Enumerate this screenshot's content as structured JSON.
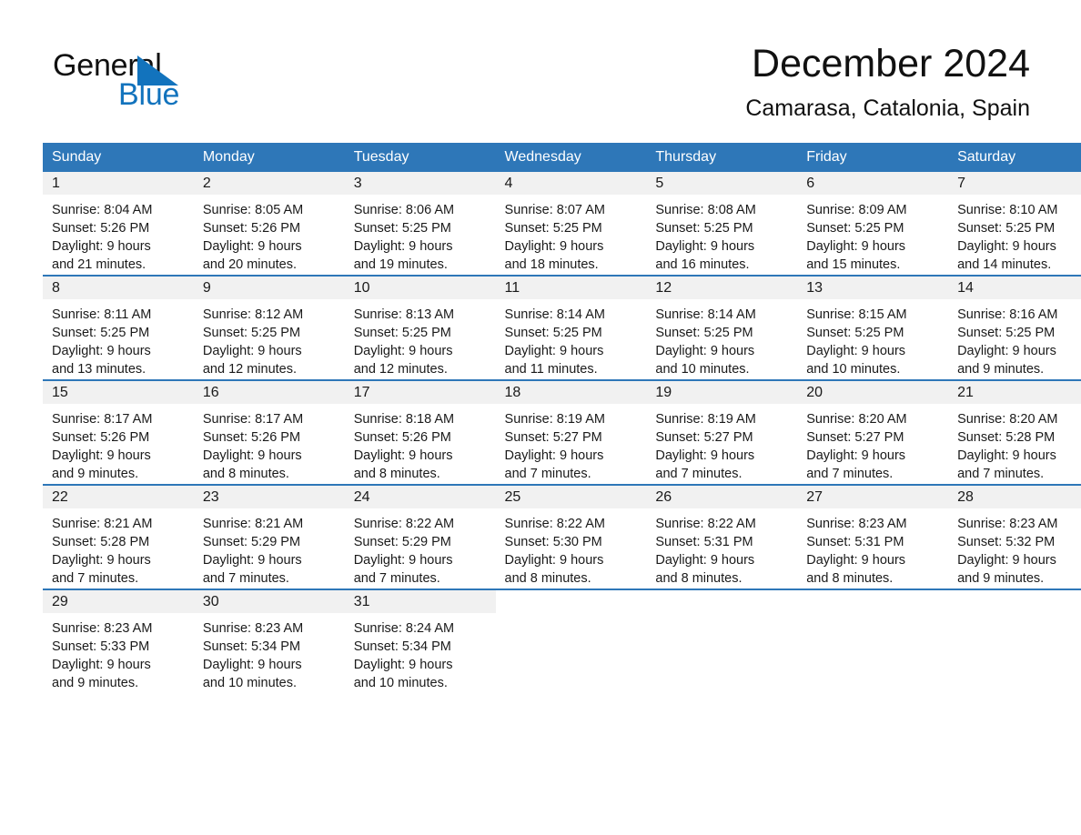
{
  "brand": {
    "name_part1": "General",
    "name_part2": "Blue",
    "accent_color": "#1273bd"
  },
  "header": {
    "title": "December 2024",
    "subtitle": "Camarasa, Catalonia, Spain"
  },
  "calendar": {
    "header_color": "#2e77b8",
    "weekday_headers": [
      "Sunday",
      "Monday",
      "Tuesday",
      "Wednesday",
      "Thursday",
      "Friday",
      "Saturday"
    ],
    "weeks": [
      [
        {
          "day": "1",
          "sunrise": "Sunrise: 8:04 AM",
          "sunset": "Sunset: 5:26 PM",
          "daylight_line1": "Daylight: 9 hours",
          "daylight_line2": "and 21 minutes."
        },
        {
          "day": "2",
          "sunrise": "Sunrise: 8:05 AM",
          "sunset": "Sunset: 5:26 PM",
          "daylight_line1": "Daylight: 9 hours",
          "daylight_line2": "and 20 minutes."
        },
        {
          "day": "3",
          "sunrise": "Sunrise: 8:06 AM",
          "sunset": "Sunset: 5:25 PM",
          "daylight_line1": "Daylight: 9 hours",
          "daylight_line2": "and 19 minutes."
        },
        {
          "day": "4",
          "sunrise": "Sunrise: 8:07 AM",
          "sunset": "Sunset: 5:25 PM",
          "daylight_line1": "Daylight: 9 hours",
          "daylight_line2": "and 18 minutes."
        },
        {
          "day": "5",
          "sunrise": "Sunrise: 8:08 AM",
          "sunset": "Sunset: 5:25 PM",
          "daylight_line1": "Daylight: 9 hours",
          "daylight_line2": "and 16 minutes."
        },
        {
          "day": "6",
          "sunrise": "Sunrise: 8:09 AM",
          "sunset": "Sunset: 5:25 PM",
          "daylight_line1": "Daylight: 9 hours",
          "daylight_line2": "and 15 minutes."
        },
        {
          "day": "7",
          "sunrise": "Sunrise: 8:10 AM",
          "sunset": "Sunset: 5:25 PM",
          "daylight_line1": "Daylight: 9 hours",
          "daylight_line2": "and 14 minutes."
        }
      ],
      [
        {
          "day": "8",
          "sunrise": "Sunrise: 8:11 AM",
          "sunset": "Sunset: 5:25 PM",
          "daylight_line1": "Daylight: 9 hours",
          "daylight_line2": "and 13 minutes."
        },
        {
          "day": "9",
          "sunrise": "Sunrise: 8:12 AM",
          "sunset": "Sunset: 5:25 PM",
          "daylight_line1": "Daylight: 9 hours",
          "daylight_line2": "and 12 minutes."
        },
        {
          "day": "10",
          "sunrise": "Sunrise: 8:13 AM",
          "sunset": "Sunset: 5:25 PM",
          "daylight_line1": "Daylight: 9 hours",
          "daylight_line2": "and 12 minutes."
        },
        {
          "day": "11",
          "sunrise": "Sunrise: 8:14 AM",
          "sunset": "Sunset: 5:25 PM",
          "daylight_line1": "Daylight: 9 hours",
          "daylight_line2": "and 11 minutes."
        },
        {
          "day": "12",
          "sunrise": "Sunrise: 8:14 AM",
          "sunset": "Sunset: 5:25 PM",
          "daylight_line1": "Daylight: 9 hours",
          "daylight_line2": "and 10 minutes."
        },
        {
          "day": "13",
          "sunrise": "Sunrise: 8:15 AM",
          "sunset": "Sunset: 5:25 PM",
          "daylight_line1": "Daylight: 9 hours",
          "daylight_line2": "and 10 minutes."
        },
        {
          "day": "14",
          "sunrise": "Sunrise: 8:16 AM",
          "sunset": "Sunset: 5:25 PM",
          "daylight_line1": "Daylight: 9 hours",
          "daylight_line2": "and 9 minutes."
        }
      ],
      [
        {
          "day": "15",
          "sunrise": "Sunrise: 8:17 AM",
          "sunset": "Sunset: 5:26 PM",
          "daylight_line1": "Daylight: 9 hours",
          "daylight_line2": "and 9 minutes."
        },
        {
          "day": "16",
          "sunrise": "Sunrise: 8:17 AM",
          "sunset": "Sunset: 5:26 PM",
          "daylight_line1": "Daylight: 9 hours",
          "daylight_line2": "and 8 minutes."
        },
        {
          "day": "17",
          "sunrise": "Sunrise: 8:18 AM",
          "sunset": "Sunset: 5:26 PM",
          "daylight_line1": "Daylight: 9 hours",
          "daylight_line2": "and 8 minutes."
        },
        {
          "day": "18",
          "sunrise": "Sunrise: 8:19 AM",
          "sunset": "Sunset: 5:27 PM",
          "daylight_line1": "Daylight: 9 hours",
          "daylight_line2": "and 7 minutes."
        },
        {
          "day": "19",
          "sunrise": "Sunrise: 8:19 AM",
          "sunset": "Sunset: 5:27 PM",
          "daylight_line1": "Daylight: 9 hours",
          "daylight_line2": "and 7 minutes."
        },
        {
          "day": "20",
          "sunrise": "Sunrise: 8:20 AM",
          "sunset": "Sunset: 5:27 PM",
          "daylight_line1": "Daylight: 9 hours",
          "daylight_line2": "and 7 minutes."
        },
        {
          "day": "21",
          "sunrise": "Sunrise: 8:20 AM",
          "sunset": "Sunset: 5:28 PM",
          "daylight_line1": "Daylight: 9 hours",
          "daylight_line2": "and 7 minutes."
        }
      ],
      [
        {
          "day": "22",
          "sunrise": "Sunrise: 8:21 AM",
          "sunset": "Sunset: 5:28 PM",
          "daylight_line1": "Daylight: 9 hours",
          "daylight_line2": "and 7 minutes."
        },
        {
          "day": "23",
          "sunrise": "Sunrise: 8:21 AM",
          "sunset": "Sunset: 5:29 PM",
          "daylight_line1": "Daylight: 9 hours",
          "daylight_line2": "and 7 minutes."
        },
        {
          "day": "24",
          "sunrise": "Sunrise: 8:22 AM",
          "sunset": "Sunset: 5:29 PM",
          "daylight_line1": "Daylight: 9 hours",
          "daylight_line2": "and 7 minutes."
        },
        {
          "day": "25",
          "sunrise": "Sunrise: 8:22 AM",
          "sunset": "Sunset: 5:30 PM",
          "daylight_line1": "Daylight: 9 hours",
          "daylight_line2": "and 8 minutes."
        },
        {
          "day": "26",
          "sunrise": "Sunrise: 8:22 AM",
          "sunset": "Sunset: 5:31 PM",
          "daylight_line1": "Daylight: 9 hours",
          "daylight_line2": "and 8 minutes."
        },
        {
          "day": "27",
          "sunrise": "Sunrise: 8:23 AM",
          "sunset": "Sunset: 5:31 PM",
          "daylight_line1": "Daylight: 9 hours",
          "daylight_line2": "and 8 minutes."
        },
        {
          "day": "28",
          "sunrise": "Sunrise: 8:23 AM",
          "sunset": "Sunset: 5:32 PM",
          "daylight_line1": "Daylight: 9 hours",
          "daylight_line2": "and 9 minutes."
        }
      ],
      [
        {
          "day": "29",
          "sunrise": "Sunrise: 8:23 AM",
          "sunset": "Sunset: 5:33 PM",
          "daylight_line1": "Daylight: 9 hours",
          "daylight_line2": "and 9 minutes."
        },
        {
          "day": "30",
          "sunrise": "Sunrise: 8:23 AM",
          "sunset": "Sunset: 5:34 PM",
          "daylight_line1": "Daylight: 9 hours",
          "daylight_line2": "and 10 minutes."
        },
        {
          "day": "31",
          "sunrise": "Sunrise: 8:24 AM",
          "sunset": "Sunset: 5:34 PM",
          "daylight_line1": "Daylight: 9 hours",
          "daylight_line2": "and 10 minutes."
        },
        {
          "day": "",
          "sunrise": "",
          "sunset": "",
          "daylight_line1": "",
          "daylight_line2": ""
        },
        {
          "day": "",
          "sunrise": "",
          "sunset": "",
          "daylight_line1": "",
          "daylight_line2": ""
        },
        {
          "day": "",
          "sunrise": "",
          "sunset": "",
          "daylight_line1": "",
          "daylight_line2": ""
        },
        {
          "day": "",
          "sunrise": "",
          "sunset": "",
          "daylight_line1": "",
          "daylight_line2": ""
        }
      ]
    ]
  }
}
